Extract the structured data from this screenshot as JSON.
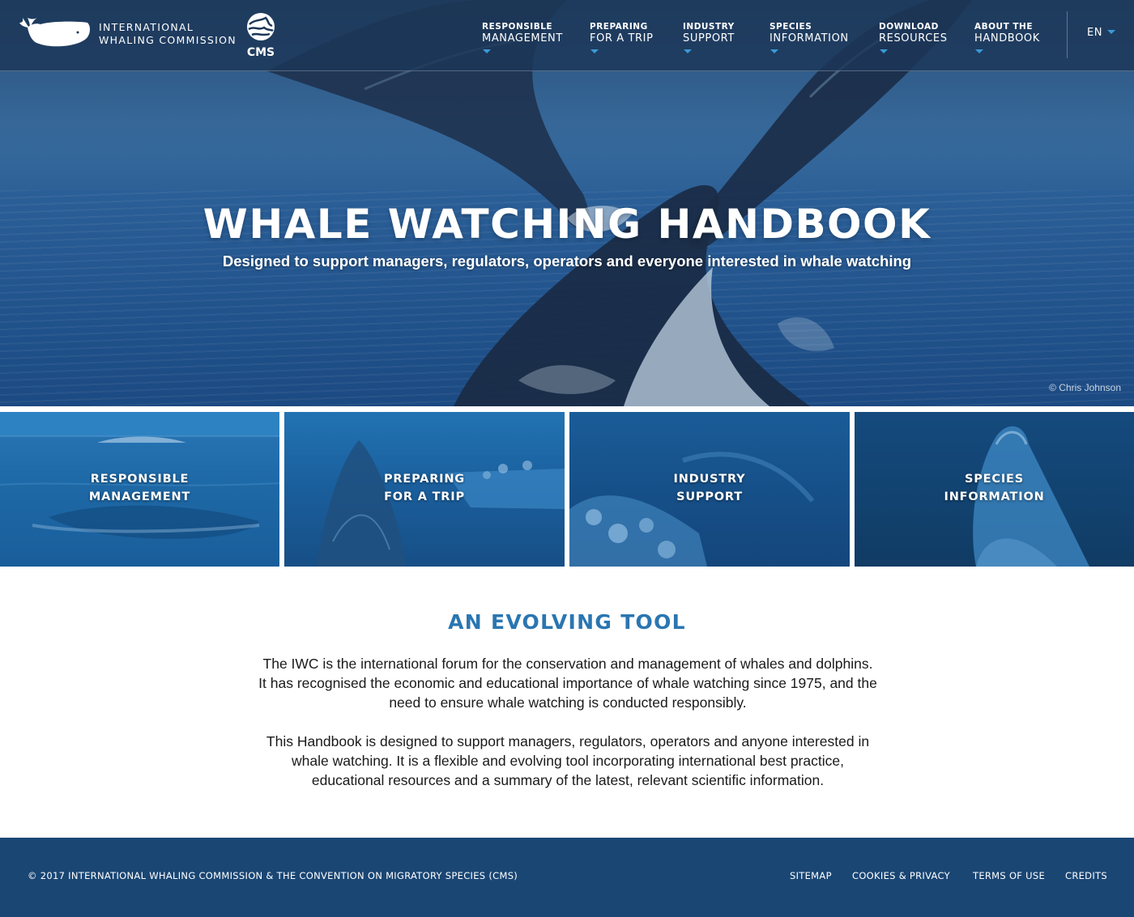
{
  "colors": {
    "header_bg": "#1c3758",
    "accent_blue": "#3a9ad9",
    "section_title": "#2a76b1",
    "footer_bg": "#1a4674",
    "tile_bg": "#1b5d98"
  },
  "header": {
    "logo_line1": "INTERNATIONAL",
    "logo_line2": "WHALING COMMISSION",
    "partner_logo_label": "CMS",
    "nav": [
      {
        "small": "RESPONSIBLE",
        "big": "MANAGEMENT"
      },
      {
        "small": "PREPARING",
        "big": "FOR A TRIP"
      },
      {
        "small": "INDUSTRY",
        "big": "SUPPORT"
      },
      {
        "small": "SPECIES",
        "big": "INFORMATION"
      },
      {
        "small": "DOWNLOAD",
        "big": "RESOURCES"
      },
      {
        "small": "ABOUT THE",
        "big": "HANDBOOK"
      }
    ],
    "language": "EN",
    "icons": {
      "logo": "whale-logo-icon",
      "partner": "cms-globe-icon",
      "dropdown": "caret-down-icon"
    }
  },
  "hero": {
    "title": "WHALE WATCHING HANDBOOK",
    "subtitle": "Designed to support managers, regulators, operators and everyone interested in whale watching",
    "photo_credit": "© Chris Johnson"
  },
  "tiles": [
    {
      "line1": "RESPONSIBLE",
      "line2": "MANAGEMENT"
    },
    {
      "line1": "PREPARING",
      "line2": "FOR A TRIP"
    },
    {
      "line1": "INDUSTRY",
      "line2": "SUPPORT"
    },
    {
      "line1": "SPECIES",
      "line2": "INFORMATION"
    }
  ],
  "main": {
    "title": "AN EVOLVING TOOL",
    "paragraph1": "The IWC is the international forum for the conservation and management of whales and dolphins. It has recognised the economic and educational importance of whale watching since 1975, and the need to ensure whale watching is conducted responsibly.",
    "paragraph2": "This Handbook is designed to support managers, regulators, operators and anyone interested in whale watching. It is a flexible and evolving tool incorporating international best practice, educational resources and a summary of the latest, relevant scientific information."
  },
  "footer": {
    "copyright": "© 2017 INTERNATIONAL WHALING COMMISSION & THE CONVENTION ON MIGRATORY SPECIES (CMS)",
    "links": [
      "SITEMAP",
      "COOKIES & PRIVACY",
      "TERMS OF USE",
      "CREDITS"
    ]
  }
}
